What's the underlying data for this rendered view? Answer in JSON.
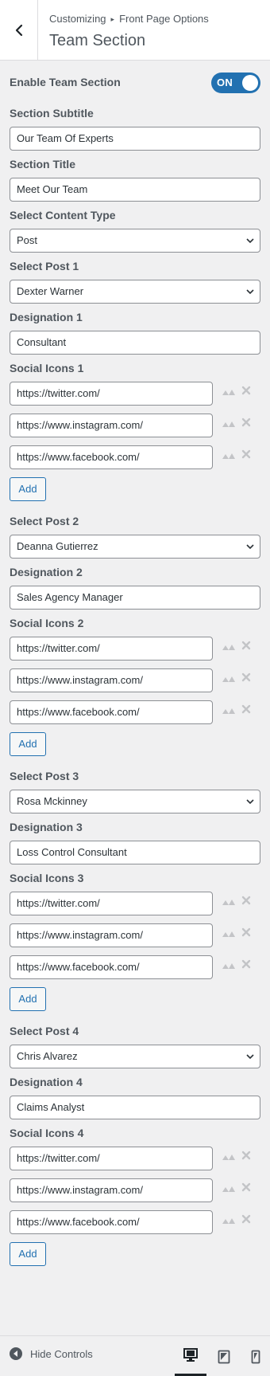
{
  "header": {
    "crumb_parent": "Customizing",
    "crumb_separator": "▸",
    "crumb_section": "Front Page Options",
    "title": "Team Section"
  },
  "enable": {
    "label": "Enable Team Section",
    "toggle_text": "ON",
    "accent": "#2271b1"
  },
  "subtitle": {
    "label": "Section Subtitle",
    "value": "Our Team Of Experts"
  },
  "section_title": {
    "label": "Section Title",
    "value": "Meet Our Team"
  },
  "content_type": {
    "label": "Select Content Type",
    "value": "Post"
  },
  "members": [
    {
      "post_label": "Select Post 1",
      "post_value": "Dexter Warner",
      "designation_label": "Designation 1",
      "designation_value": "Consultant",
      "social_label": "Social Icons 1",
      "social": [
        "https://twitter.com/",
        "https://www.instagram.com/",
        "https://www.facebook.com/"
      ],
      "add_label": "Add"
    },
    {
      "post_label": "Select Post 2",
      "post_value": "Deanna Gutierrez",
      "designation_label": "Designation 2",
      "designation_value": "Sales Agency Manager",
      "social_label": "Social Icons 2",
      "social": [
        "https://twitter.com/",
        "https://www.instagram.com/",
        "https://www.facebook.com/"
      ],
      "add_label": "Add"
    },
    {
      "post_label": "Select Post 3",
      "post_value": "Rosa Mckinney",
      "designation_label": "Designation 3",
      "designation_value": "Loss Control Consultant",
      "social_label": "Social Icons 3",
      "social": [
        "https://twitter.com/",
        "https://www.instagram.com/",
        "https://www.facebook.com/"
      ],
      "add_label": "Add"
    },
    {
      "post_label": "Select Post 4",
      "post_value": "Chris Alvarez",
      "designation_label": "Designation 4",
      "designation_value": "Claims Analyst",
      "social_label": "Social Icons 4",
      "social": [
        "https://twitter.com/",
        "https://www.instagram.com/",
        "https://www.facebook.com/"
      ],
      "add_label": "Add"
    }
  ],
  "footer": {
    "hide_controls": "Hide Controls",
    "devices": [
      "desktop-icon",
      "tablet-icon",
      "mobile-icon"
    ],
    "active_device": "desktop"
  }
}
